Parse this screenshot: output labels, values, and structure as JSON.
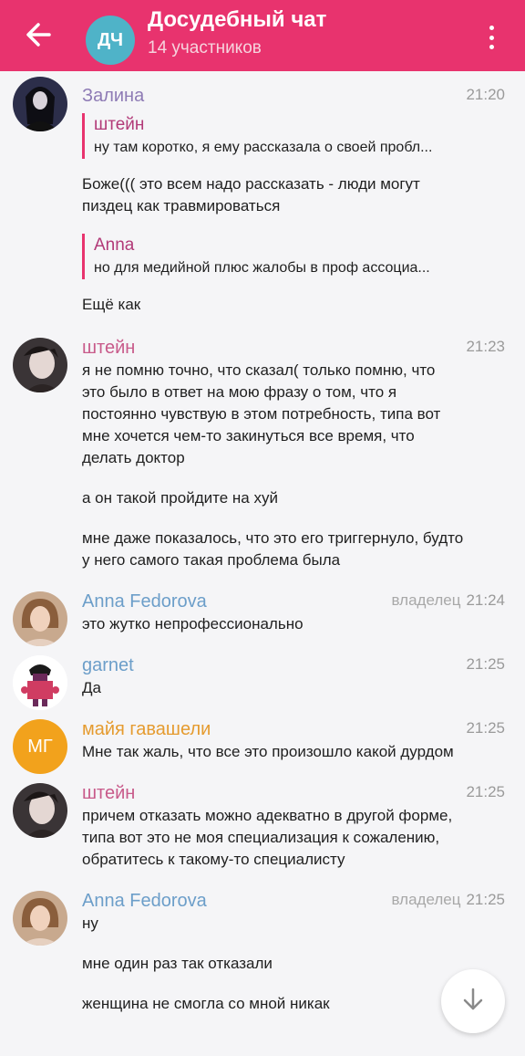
{
  "header": {
    "avatar_initials": "ДЧ",
    "title": "Досудебный чат",
    "subtitle": "14 участников"
  },
  "colors": {
    "header_bg": "#e8336e",
    "avatar_dch": "#4fb3c8",
    "avatar_mg": "#f2a21c",
    "name_purple": "#8e7bb5",
    "name_pink": "#c85a8a",
    "name_blue": "#6c9ec9",
    "name_orange": "#e59b2f"
  },
  "messages": {
    "m1": {
      "sender": "Залина",
      "time": "21:20",
      "quote1": {
        "name": "штейн",
        "text": "ну там коротко, я ему рассказала о своей пробл..."
      },
      "text1a": "Боже((( это всем надо рассказать - люди могут",
      "text1b": "пиздец как травмироваться",
      "quote2": {
        "name": "Anna",
        "text": "но для медийной плюс жалобы в проф ассоциа..."
      },
      "text2": "Ещё как"
    },
    "m2": {
      "sender": "штейн",
      "time": "21:23",
      "p1": [
        "я не помню точно, что сказал( только помню, что",
        "это было в ответ на мою фразу о том, что я",
        "постоянно чувствую в этом потребность, типа вот",
        "мне хочется чем-то закинуться все время, что",
        "делать доктор"
      ],
      "p2": "а он такой пройдите на хуй",
      "p3": [
        "мне даже показалось, что это его триггернуло, будто",
        "у него самого такая проблема была"
      ]
    },
    "m3": {
      "sender": "Anna Fedorova",
      "owner": "владелец",
      "time": "21:24",
      "text": "это жутко непрофессионально"
    },
    "m4": {
      "sender": "garnet",
      "time": "21:25",
      "text": "Да"
    },
    "m5": {
      "sender": "майя гавашели",
      "avatar_initials": "МГ",
      "time": "21:25",
      "text": "Мне так жаль, что все это произошло какой дурдом"
    },
    "m6": {
      "sender": "штейн",
      "time": "21:25",
      "lines": [
        "причем отказать можно адекватно в другой форме,",
        "типа вот это не моя специализация к сожалению,",
        "обратитесь к такому-то специалисту"
      ]
    },
    "m7": {
      "sender": "Anna Fedorova",
      "owner": "владелец",
      "time": "21:25",
      "p1": "ну",
      "p2": "мне один раз так отказали",
      "p3": "женщина не смогла со мной никак"
    }
  },
  "icons": {
    "back": "arrow-left-icon",
    "menu": "more-vertical-icon",
    "scroll": "arrow-down-icon"
  }
}
